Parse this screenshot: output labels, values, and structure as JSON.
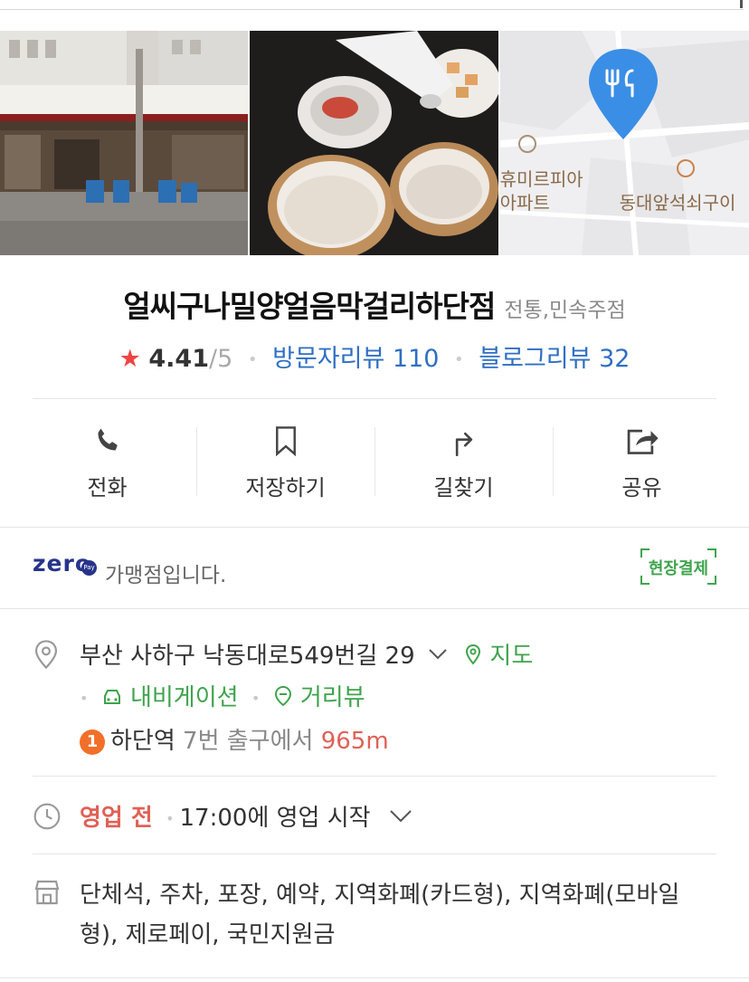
{
  "photos": {
    "map_labels": [
      "휴미르피아",
      "아파트",
      "동대앞석쇠구이"
    ]
  },
  "place": {
    "name": "얼씨구나밀양얼음막걸리하단점",
    "category": "전통,민속주점",
    "rating": "4.41",
    "rating_max": "/5",
    "visitor_reviews_label": "방문자리뷰",
    "visitor_reviews_count": "110",
    "blog_reviews_label": "블로그리뷰",
    "blog_reviews_count": "32"
  },
  "actions": {
    "call": "전화",
    "save": "저장하기",
    "directions": "길찾기",
    "share": "공유"
  },
  "zeropay": {
    "logo": "zero",
    "logo_badge": "Pay",
    "text": "가맹점입니다.",
    "onsite_payment": "현장결제"
  },
  "address": {
    "text": "부산 사하구 낙동대로549번길 29",
    "map_link": "지도",
    "navigation_link": "내비게이션",
    "streetview_link": "거리뷰"
  },
  "subway": {
    "line": "1",
    "station": "하단역",
    "exit": "7번 출구에서",
    "distance": "965m"
  },
  "hours": {
    "status": "영업 전",
    "detail": "17:00에 영업 시작"
  },
  "facilities": {
    "text": "단체석, 주차, 포장, 예약, 지역화폐(카드형), 지역화폐(모바일형), 제로페이, 국민지원금"
  },
  "colors": {
    "star": "#ee4444",
    "link_blue": "#2f6fc4",
    "green": "#3fa34d",
    "closed_red": "#e06156",
    "subway_line1": "#f26f29",
    "zeropay_navy": "#27348b",
    "map_pin": "#3a8ee6"
  },
  "icons": [
    "phone-icon",
    "bookmark-icon",
    "directions-icon",
    "share-icon",
    "location-pin-icon",
    "chevron-down-icon",
    "map-pin-icon",
    "car-icon",
    "streetview-icon",
    "clock-icon",
    "store-icon",
    "star-icon"
  ]
}
